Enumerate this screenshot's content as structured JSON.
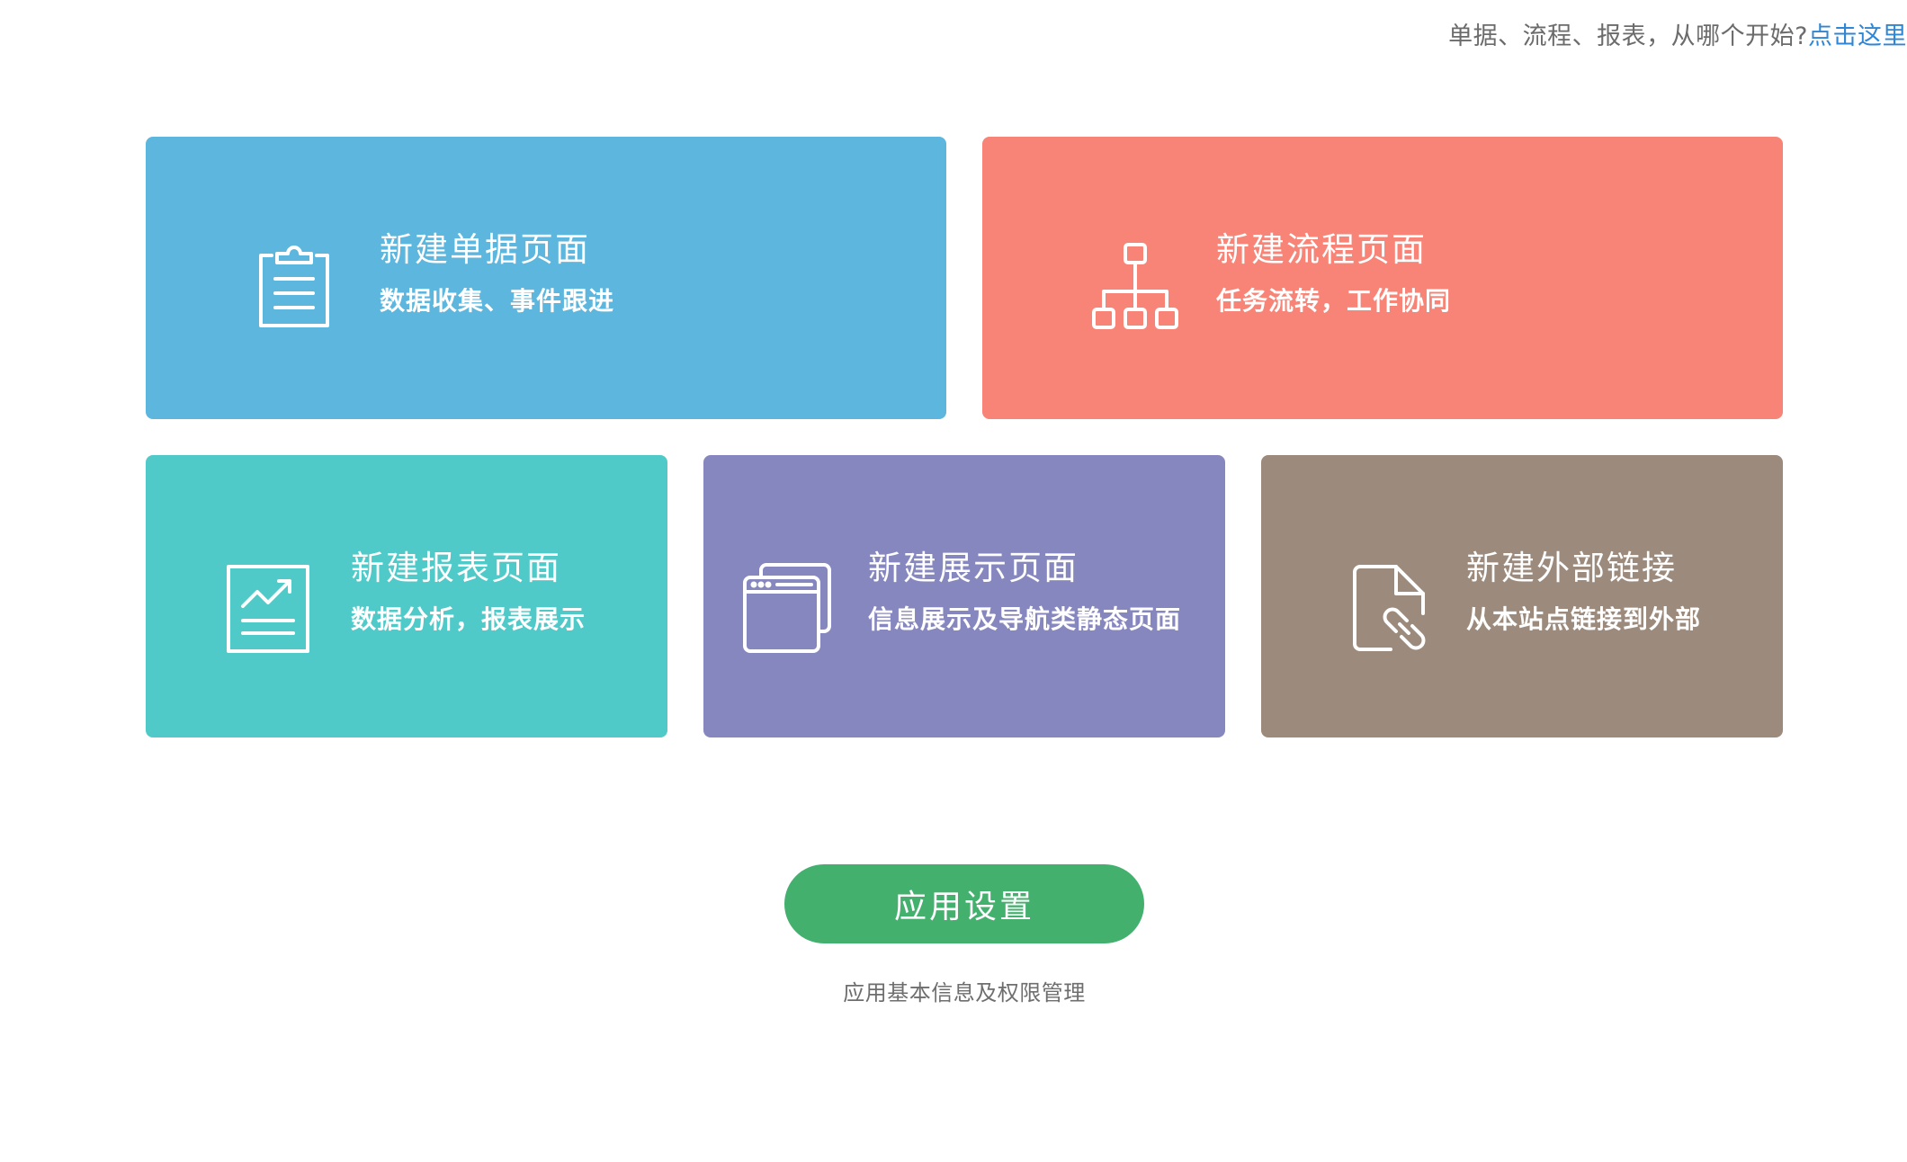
{
  "header": {
    "hint_text": "单据、流程、报表，从哪个开始?",
    "hint_link": "点击这里",
    "link_color": "#2f86d4"
  },
  "cards": [
    {
      "title": "新建单据页面",
      "desc": "数据收集、事件跟进",
      "icon": "clipboard-icon",
      "color": "#5db6dd"
    },
    {
      "title": "新建流程页面",
      "desc": "任务流转，工作协同",
      "icon": "flowchart-icon",
      "color": "#f88477"
    },
    {
      "title": "新建报表页面",
      "desc": "数据分析，报表展示",
      "icon": "chart-icon",
      "color": "#50cac8"
    },
    {
      "title": "新建展示页面",
      "desc": "信息展示及导航类静态页面",
      "icon": "windows-icon",
      "color": "#8787c0"
    },
    {
      "title": "新建外部链接",
      "desc": "从本站点链接到外部",
      "icon": "file-link-icon",
      "color": "#9c8b7d"
    }
  ],
  "settings": {
    "button_label": "应用设置",
    "subtitle": "应用基本信息及权限管理",
    "color": "#44b06e"
  }
}
